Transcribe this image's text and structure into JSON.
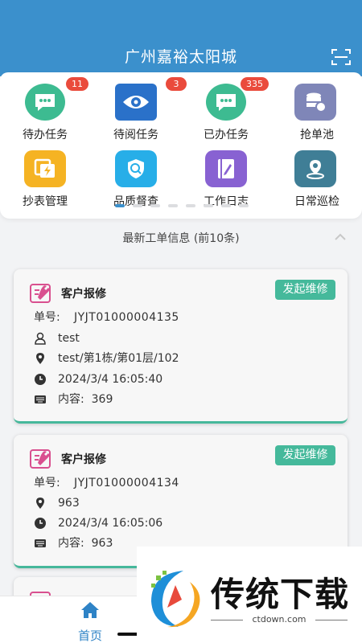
{
  "header": {
    "title": "广州嘉裕太阳城",
    "scan_icon": "scan-icon"
  },
  "grid": [
    {
      "label": "待办任务",
      "badge": "11",
      "icon": "chat-bubble-icon",
      "color": "#3dbb91"
    },
    {
      "label": "待阅任务",
      "badge": "3",
      "icon": "eye-icon",
      "color": "#2a71c9"
    },
    {
      "label": "已办任务",
      "badge": "335",
      "icon": "chat-bubble-icon",
      "color": "#3dbb91"
    },
    {
      "label": "抢单池",
      "badge": "",
      "icon": "database-icon",
      "color": "#7f86b8"
    },
    {
      "label": "抄表管理",
      "badge": "",
      "icon": "meter-icon",
      "color": "#f5b323"
    },
    {
      "label": "品质督查",
      "badge": "",
      "icon": "shield-search-icon",
      "color": "#27aee8"
    },
    {
      "label": "工作日志",
      "badge": "",
      "icon": "notebook-icon",
      "color": "#8862d2"
    },
    {
      "label": "日常巡检",
      "badge": "",
      "icon": "location-pin-icon",
      "color": "#3f7e96"
    }
  ],
  "pager": {
    "count": 8,
    "active": 0
  },
  "section": {
    "title": "最新工单信息 (前10条)"
  },
  "orders": [
    {
      "type": "客户报修",
      "action": "发起维修",
      "order_label": "单号:",
      "order_no": "JYJT01000004135",
      "user": "test",
      "location": "test/第1栋/第01层/102",
      "time": "2024/3/4 16:05:40",
      "content_label": "内容:",
      "content": "369"
    },
    {
      "type": "客户报修",
      "action": "发起维修",
      "order_label": "单号:",
      "order_no": "JYJT01000004134",
      "location": "963",
      "time": "2024/3/4 16:05:06",
      "content_label": "内容:",
      "content": "963"
    }
  ],
  "tabbar": {
    "home_label": "首页"
  },
  "watermark": {
    "name": "传统下载",
    "url": "ctdown.com"
  },
  "colors": {
    "primary": "#3b90cc",
    "accent": "#45b99b",
    "badge": "#ea4b3c"
  }
}
